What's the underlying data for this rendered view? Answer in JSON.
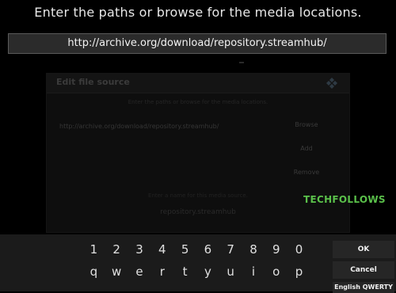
{
  "prompt": "Enter the paths or browse for the media locations.",
  "url_value": "http://archive.org/download/repository.streamhub/",
  "dialog": {
    "title": "Edit file source",
    "subtitle": "Enter the paths or browse for the media locations.",
    "path": "http://archive.org/download/repository.streamhub/",
    "browse": "Browse",
    "add": "Add",
    "remove": "Remove",
    "name_note": "Enter a name for this media source.",
    "name_value": "repository.streamhub"
  },
  "watermark": "TECHFOLLOWS",
  "keyboard": {
    "numbers": [
      "1",
      "2",
      "3",
      "4",
      "5",
      "6",
      "7",
      "8",
      "9",
      "0"
    ],
    "letters": [
      "q",
      "w",
      "e",
      "r",
      "t",
      "y",
      "u",
      "i",
      "o",
      "p"
    ],
    "ok": "OK",
    "cancel": "Cancel",
    "layout": "English QWERTY"
  },
  "colors": {
    "watermark": "#5ac04a",
    "background": "#000000"
  }
}
